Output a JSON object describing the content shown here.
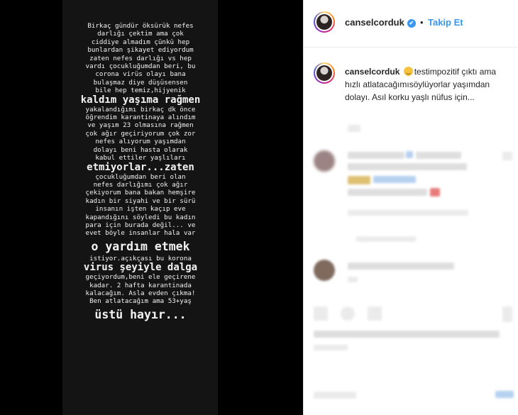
{
  "story": {
    "lines": [
      "Birkaç gündür öksürük nefes",
      "darlığı çektim ama çok",
      "ciddiye almadım çünkü hep",
      "bunlardan şikayet ediyordum",
      "zaten nefes darlığı vs hep",
      "vardı çocukluğumdan beri, bu",
      "corona virüs olayı bana",
      "bulaşmaz diye düşüsensen",
      "bile hep temiz,hijyenik"
    ],
    "big1": "kaldım yaşıma rağmen",
    "lines2": [
      "yakalandığımı birkaç dk önce",
      "öğrendim karantinaya alındım",
      "ve yaşım 23 olmasına rağmen",
      "çok ağır geçiriyorum çok zor",
      "nefes alıyorum yaşımdan",
      "dolayı beni hasta olarak",
      "kabul ettiler yaşlıları"
    ],
    "big2": "etmiyorlar...zaten",
    "lines3": [
      "çocukluğumdan beri olan",
      "nefes darlığımı çok ağır",
      "çekiyorum bana bakan hemşire",
      "kadın bir siyahi ve bir sürü",
      "insanın işten kaçıp eve",
      "kapandığını söyledi bu kadın",
      "para için burada değil... ve",
      "evet böyle insanlar hala var"
    ],
    "big3": "o yardım etmek",
    "lines4": [
      "istiyor.açıkçası bu korona"
    ],
    "big4": "virus şeyiyle dalga",
    "lines5": [
      "geçiyordum,beni ele geçirene",
      "kadar. 2 hafta karantinada",
      "kalacağım. Asla evden çıkma!",
      "Ben atlatacağım ama 53+yaş"
    ],
    "big5": "üstü hayır..."
  },
  "header": {
    "username": "canselcorduk",
    "verified_mark": "✔",
    "separator": "•",
    "follow_label": "Takip Et"
  },
  "caption": {
    "username": "canselcorduk",
    "text": "testimpozitif çıktı ama hızlı atlatacağımısöylüyorlar yaşımdan dolayı. Asıl korku yaşlı nüfus için..."
  },
  "icons": {
    "verified": "verified-badge-icon",
    "emoji": "smiling-face-emoji-icon"
  },
  "colors": {
    "accent": "#3897f0",
    "story_bg": "#141414",
    "text": "#262626"
  }
}
